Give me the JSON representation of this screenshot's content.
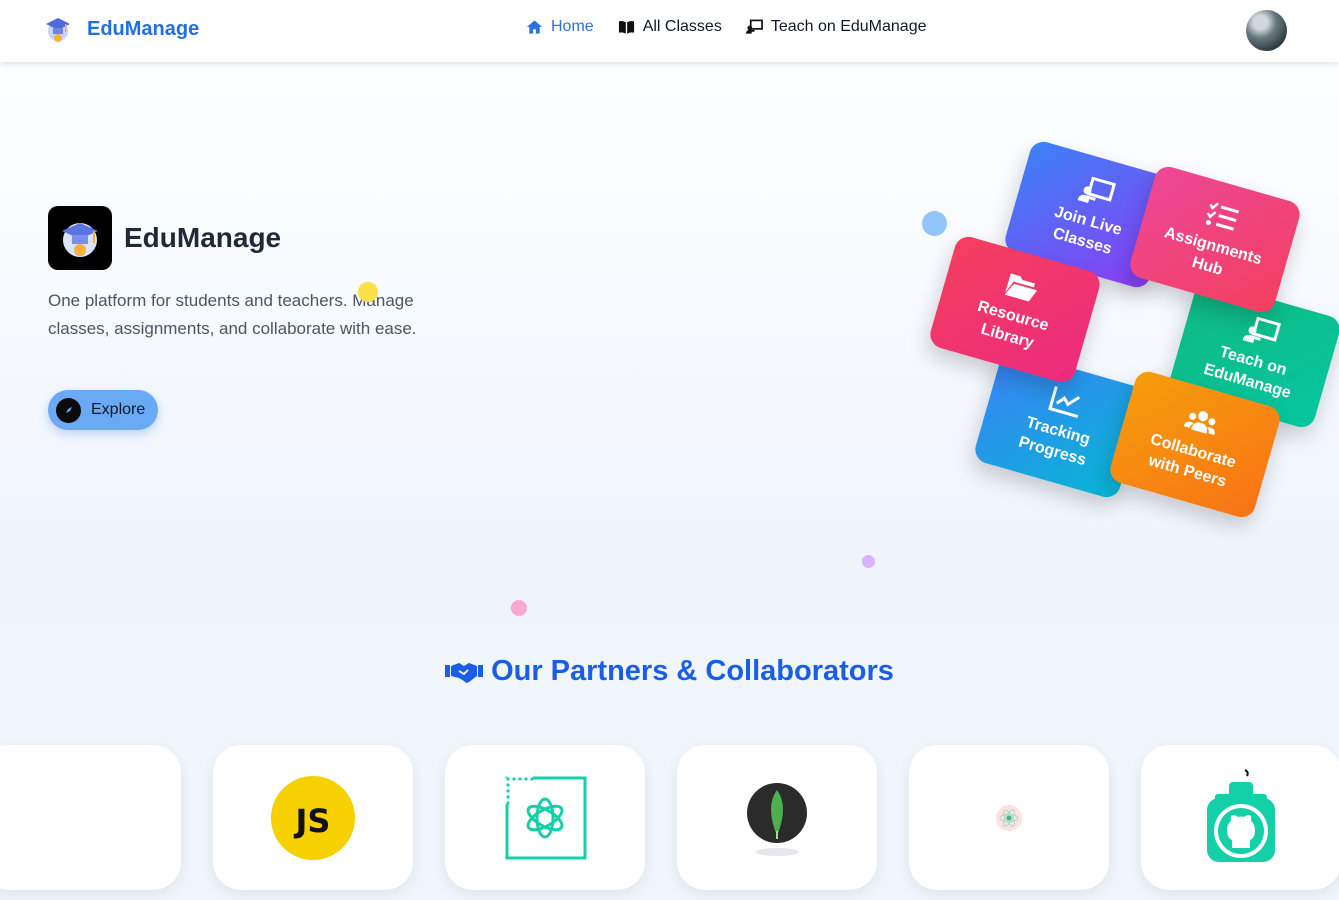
{
  "navbar": {
    "brand_name": "EduManage",
    "links": [
      {
        "label": "Home",
        "icon": "home-icon",
        "active": true
      },
      {
        "label": "All Classes",
        "icon": "book-open-icon",
        "active": false
      },
      {
        "label": "Teach on EduManage",
        "icon": "chalkboard-teacher-icon",
        "active": false
      }
    ]
  },
  "hero": {
    "title": "EduManage",
    "description": "One platform for students and teachers. Manage classes, assignments, and collaborate with ease.",
    "explore_label": "Explore",
    "tiles": [
      {
        "line1": "Join Live",
        "line2": "Classes",
        "icon": "chalkboard-teacher-icon"
      },
      {
        "line1": "Assignments",
        "line2": "Hub",
        "icon": "list-check-icon"
      },
      {
        "line1": "Resource",
        "line2": "Library",
        "icon": "folder-open-icon"
      },
      {
        "line1": "Teach on",
        "line2": "EduManage",
        "icon": "chalkboard-teacher-icon"
      },
      {
        "line1": "Tracking",
        "line2": "Progress",
        "icon": "chart-line-icon"
      },
      {
        "line1": "Collaborate",
        "line2": "with Peers",
        "icon": "users-icon"
      }
    ]
  },
  "partners": {
    "title": "Our Partners & Collaborators",
    "logos": [
      "blank",
      "javascript-logo",
      "openai-logo",
      "mongodb-logo",
      "react-logo",
      "github-logo"
    ],
    "js_text": "JS"
  },
  "colors": {
    "brand_blue": "#1f6fe5",
    "explore_bg": "#6aa9f4"
  }
}
